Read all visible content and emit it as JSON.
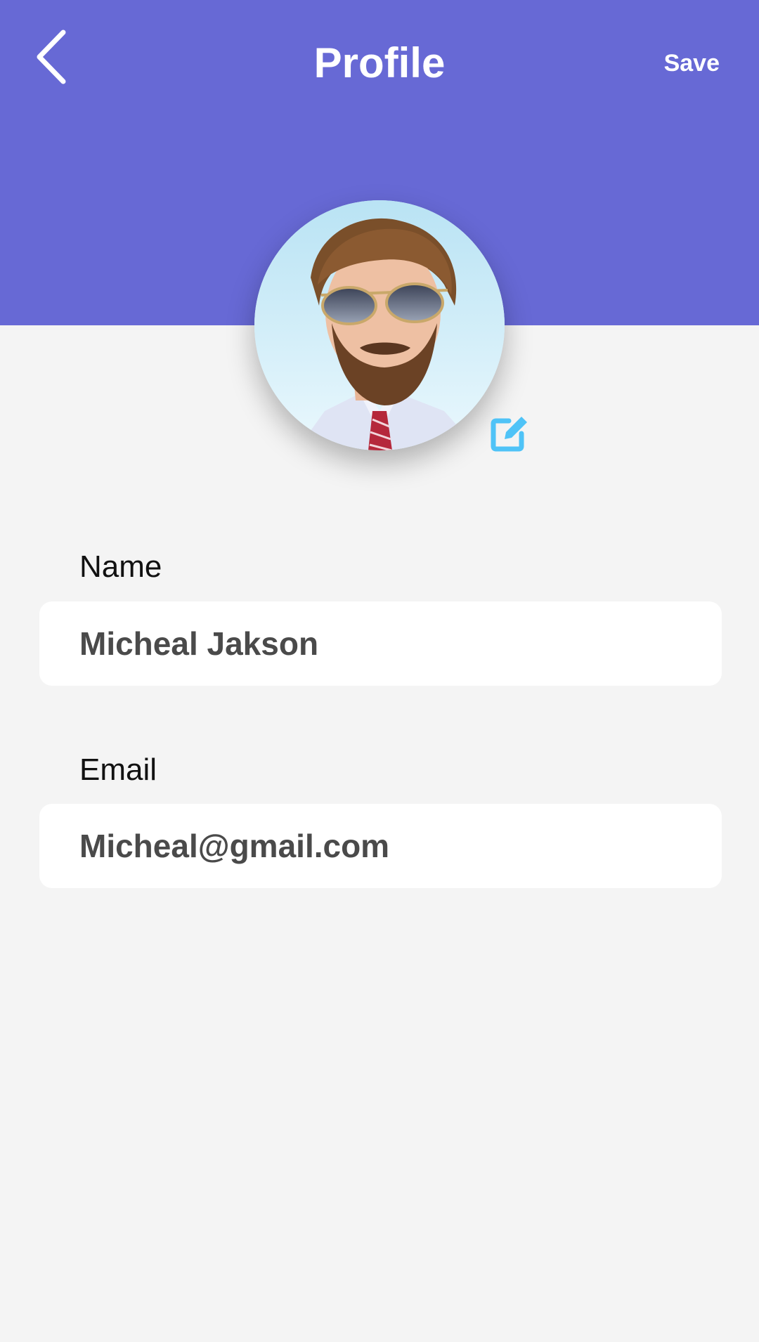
{
  "header": {
    "title": "Profile",
    "save_label": "Save",
    "background_color": "#6769d5",
    "back_icon": "chevron-left-icon"
  },
  "profile": {
    "avatar": "profile-photo",
    "edit_icon": "edit-icon",
    "edit_icon_color": "#4fc3f7"
  },
  "form": {
    "name": {
      "label": "Name",
      "value": "Micheal Jakson"
    },
    "email": {
      "label": "Email",
      "value": "Micheal@gmail.com"
    }
  }
}
